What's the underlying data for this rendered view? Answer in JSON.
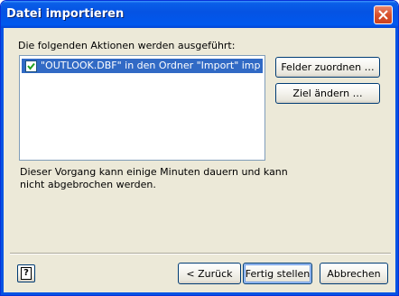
{
  "window": {
    "title": "Datei importieren"
  },
  "intro_label": "Die folgenden Aktionen werden ausgeführt:",
  "actions_list": {
    "items": [
      {
        "checked": true,
        "label": "\"OUTLOOK.DBF\" in den Ordner \"Import\" importie…"
      }
    ]
  },
  "side_buttons": {
    "map_fields": "Felder zuordnen …",
    "change_target": "Ziel ändern …"
  },
  "info_text": {
    "line1": "Dieser Vorgang kann einige Minuten dauern und kann",
    "line2": "nicht abgebrochen werden."
  },
  "footer": {
    "help_label": "?",
    "back": "< Zurück",
    "finish": "Fertig stellen",
    "cancel": "Abbrechen"
  },
  "icons": {
    "close": "close-icon",
    "check": "checkmark-icon",
    "help": "help-icon"
  },
  "colors": {
    "title_bar": "#0553e3",
    "dialog_bg": "#ece9d8",
    "selection": "#316ac5",
    "close_button": "#d8512c"
  }
}
